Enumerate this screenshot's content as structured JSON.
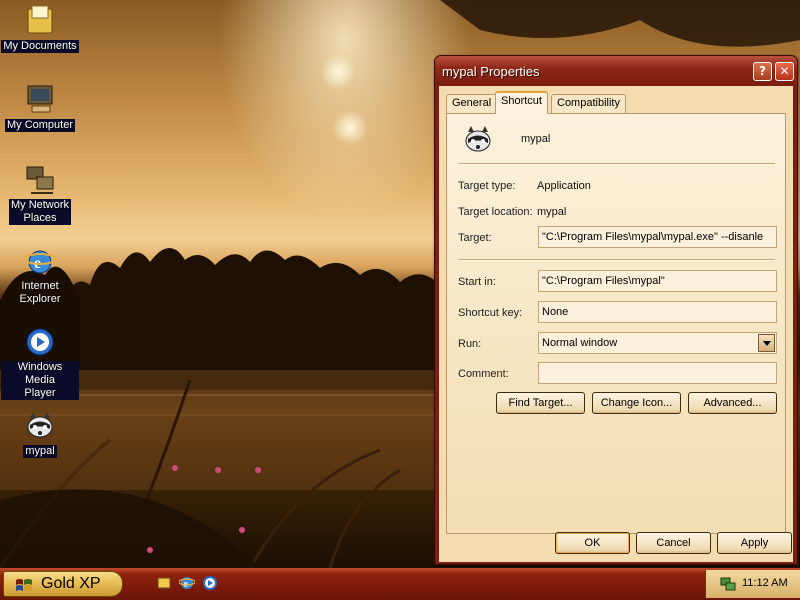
{
  "desktop": {
    "icons": [
      {
        "label": "My Documents"
      },
      {
        "label": "My Computer"
      },
      {
        "label_line1": "My Network",
        "label_line2": "Places"
      },
      {
        "label_line1": "Internet",
        "label_line2": "Explorer"
      },
      {
        "label_line1": "Windows Media",
        "label_line2": "Player"
      },
      {
        "label": "mypal"
      }
    ]
  },
  "dialog": {
    "title": "mypal Properties",
    "help_glyph": "?",
    "close_glyph": "✕",
    "tabs": [
      {
        "label": "General"
      },
      {
        "label": "Shortcut",
        "active": true
      },
      {
        "label": "Compatibility"
      }
    ],
    "shortcut": {
      "name": "mypal",
      "target_type_label": "Target type:",
      "target_type_value": "Application",
      "target_location_label": "Target location:",
      "target_location_value": "mypal",
      "target_label": "Target:",
      "target_value": "\"C:\\Program Files\\mypal\\mypal.exe\" --disanle",
      "start_in_label": "Start in:",
      "start_in_value": "\"C:\\Program Files\\mypal\"",
      "shortcut_key_label": "Shortcut key:",
      "shortcut_key_value": "None",
      "run_label": "Run:",
      "run_value": "Normal window",
      "comment_label": "Comment:",
      "comment_value": "",
      "find_target_label": "Find Target...",
      "change_icon_label": "Change Icon...",
      "advanced_label": "Advanced..."
    },
    "buttons": {
      "ok": "OK",
      "cancel": "Cancel",
      "apply": "Apply"
    }
  },
  "taskbar": {
    "start_label": "Gold XP",
    "clock": "11:12 AM"
  },
  "colors": {
    "title_bar": "#8d2818",
    "dialog_face": "#f2dcb0",
    "taskbar": "#7c1a0a",
    "start_button": "#e8bd55"
  }
}
